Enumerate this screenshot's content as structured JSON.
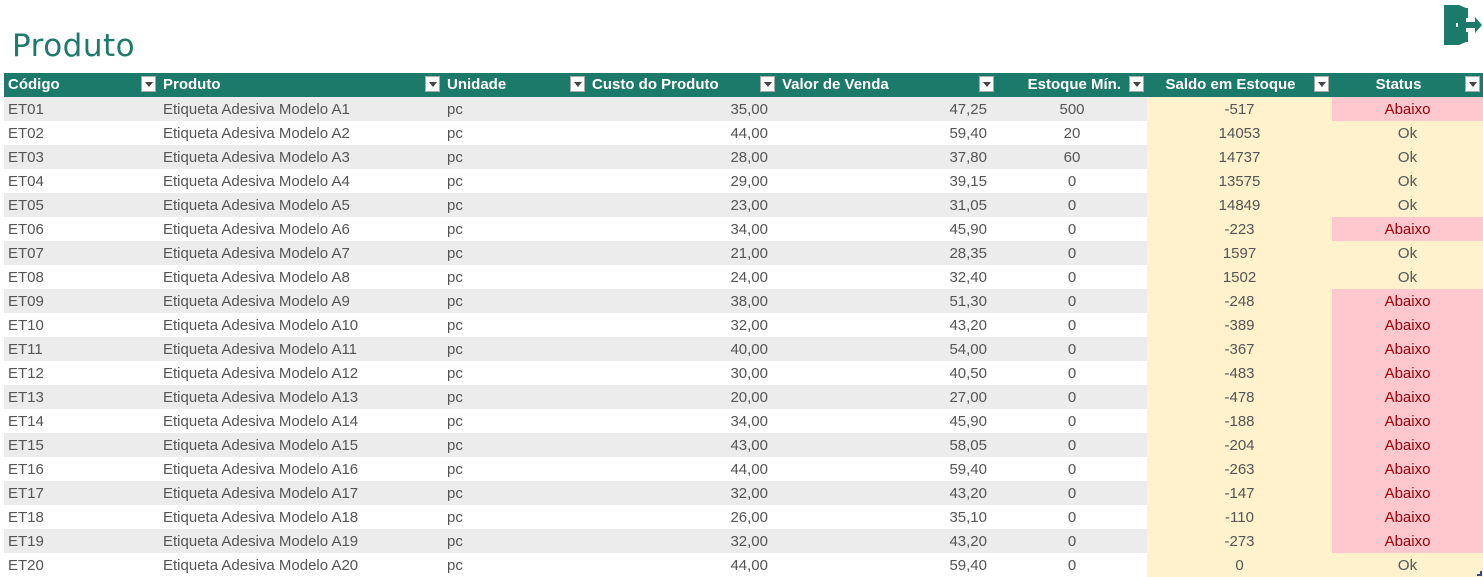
{
  "page": {
    "title": "Produto"
  },
  "toolbar": {
    "exit_icon": "exit-door-icon",
    "accent_color": "#1c7a6a"
  },
  "table": {
    "headers": {
      "codigo": "Código",
      "produto": "Produto",
      "unidade": "Unidade",
      "custo": "Custo do Produto",
      "valor": "Valor de Venda",
      "estoque_min": "Estoque Mín.",
      "saldo": "Saldo em Estoque",
      "status": "Status"
    },
    "colors": {
      "header_bg": "#1c7a6a",
      "saldo_bg": "#fff2cc",
      "abaixo_bg": "#ffc7ce",
      "abaixo_text": "#9c0006"
    },
    "rows": [
      {
        "codigo": "ET01",
        "produto": "Etiqueta Adesiva Modelo A1",
        "unidade": "pc",
        "custo": "35,00",
        "valor": "47,25",
        "estoque_min": "500",
        "saldo": "-517",
        "status": "Abaixo"
      },
      {
        "codigo": "ET02",
        "produto": "Etiqueta Adesiva Modelo A2",
        "unidade": "pc",
        "custo": "44,00",
        "valor": "59,40",
        "estoque_min": "20",
        "saldo": "14053",
        "status": "Ok"
      },
      {
        "codigo": "ET03",
        "produto": "Etiqueta Adesiva Modelo A3",
        "unidade": "pc",
        "custo": "28,00",
        "valor": "37,80",
        "estoque_min": "60",
        "saldo": "14737",
        "status": "Ok"
      },
      {
        "codigo": "ET04",
        "produto": "Etiqueta Adesiva Modelo A4",
        "unidade": "pc",
        "custo": "29,00",
        "valor": "39,15",
        "estoque_min": "0",
        "saldo": "13575",
        "status": "Ok"
      },
      {
        "codigo": "ET05",
        "produto": "Etiqueta Adesiva Modelo A5",
        "unidade": "pc",
        "custo": "23,00",
        "valor": "31,05",
        "estoque_min": "0",
        "saldo": "14849",
        "status": "Ok"
      },
      {
        "codigo": "ET06",
        "produto": "Etiqueta Adesiva Modelo A6",
        "unidade": "pc",
        "custo": "34,00",
        "valor": "45,90",
        "estoque_min": "0",
        "saldo": "-223",
        "status": "Abaixo"
      },
      {
        "codigo": "ET07",
        "produto": "Etiqueta Adesiva Modelo A7",
        "unidade": "pc",
        "custo": "21,00",
        "valor": "28,35",
        "estoque_min": "0",
        "saldo": "1597",
        "status": "Ok"
      },
      {
        "codigo": "ET08",
        "produto": "Etiqueta Adesiva Modelo A8",
        "unidade": "pc",
        "custo": "24,00",
        "valor": "32,40",
        "estoque_min": "0",
        "saldo": "1502",
        "status": "Ok"
      },
      {
        "codigo": "ET09",
        "produto": "Etiqueta Adesiva Modelo A9",
        "unidade": "pc",
        "custo": "38,00",
        "valor": "51,30",
        "estoque_min": "0",
        "saldo": "-248",
        "status": "Abaixo"
      },
      {
        "codigo": "ET10",
        "produto": "Etiqueta Adesiva Modelo A10",
        "unidade": "pc",
        "custo": "32,00",
        "valor": "43,20",
        "estoque_min": "0",
        "saldo": "-389",
        "status": "Abaixo"
      },
      {
        "codigo": "ET11",
        "produto": "Etiqueta Adesiva Modelo A11",
        "unidade": "pc",
        "custo": "40,00",
        "valor": "54,00",
        "estoque_min": "0",
        "saldo": "-367",
        "status": "Abaixo"
      },
      {
        "codigo": "ET12",
        "produto": "Etiqueta Adesiva Modelo A12",
        "unidade": "pc",
        "custo": "30,00",
        "valor": "40,50",
        "estoque_min": "0",
        "saldo": "-483",
        "status": "Abaixo"
      },
      {
        "codigo": "ET13",
        "produto": "Etiqueta Adesiva Modelo A13",
        "unidade": "pc",
        "custo": "20,00",
        "valor": "27,00",
        "estoque_min": "0",
        "saldo": "-478",
        "status": "Abaixo"
      },
      {
        "codigo": "ET14",
        "produto": "Etiqueta Adesiva Modelo A14",
        "unidade": "pc",
        "custo": "34,00",
        "valor": "45,90",
        "estoque_min": "0",
        "saldo": "-188",
        "status": "Abaixo"
      },
      {
        "codigo": "ET15",
        "produto": "Etiqueta Adesiva Modelo A15",
        "unidade": "pc",
        "custo": "43,00",
        "valor": "58,05",
        "estoque_min": "0",
        "saldo": "-204",
        "status": "Abaixo"
      },
      {
        "codigo": "ET16",
        "produto": "Etiqueta Adesiva Modelo A16",
        "unidade": "pc",
        "custo": "44,00",
        "valor": "59,40",
        "estoque_min": "0",
        "saldo": "-263",
        "status": "Abaixo"
      },
      {
        "codigo": "ET17",
        "produto": "Etiqueta Adesiva Modelo A17",
        "unidade": "pc",
        "custo": "32,00",
        "valor": "43,20",
        "estoque_min": "0",
        "saldo": "-147",
        "status": "Abaixo"
      },
      {
        "codigo": "ET18",
        "produto": "Etiqueta Adesiva Modelo A18",
        "unidade": "pc",
        "custo": "26,00",
        "valor": "35,10",
        "estoque_min": "0",
        "saldo": "-110",
        "status": "Abaixo"
      },
      {
        "codigo": "ET19",
        "produto": "Etiqueta Adesiva Modelo A19",
        "unidade": "pc",
        "custo": "32,00",
        "valor": "43,20",
        "estoque_min": "0",
        "saldo": "-273",
        "status": "Abaixo"
      },
      {
        "codigo": "ET20",
        "produto": "Etiqueta Adesiva Modelo A20",
        "unidade": "pc",
        "custo": "44,00",
        "valor": "59,40",
        "estoque_min": "0",
        "saldo": "0",
        "status": "Ok"
      }
    ]
  }
}
